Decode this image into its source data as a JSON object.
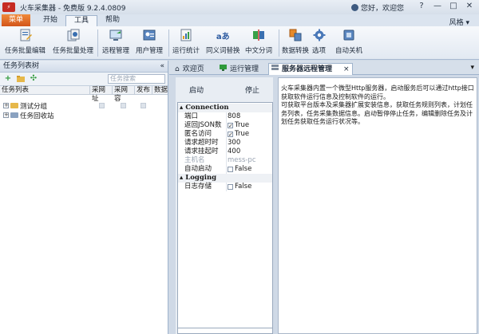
{
  "window": {
    "title": "火车采集器 - 免费版 9.2.4.0809",
    "welcome": "您好，欢迎您",
    "app_icon_glyph": "⚡",
    "controls": [
      "?",
      "—",
      "□",
      "✕"
    ]
  },
  "ribbon": {
    "menu_label": "菜单",
    "tabs": [
      "开始",
      "工具",
      "帮助"
    ],
    "active_tab": "工具",
    "style_menu": "风格 ▾",
    "buttons": [
      {
        "label": "任务批量编辑",
        "icon": "batch-edit-icon"
      },
      {
        "label": "任务批量处理",
        "icon": "batch-process-icon"
      },
      {
        "label": "远程管理",
        "icon": "remote-manage-icon"
      },
      {
        "label": "用户管理",
        "icon": "user-manage-icon"
      },
      {
        "label": "运行统计",
        "icon": "run-stats-icon"
      },
      {
        "label": "同义词替换",
        "icon": "synonym-replace-icon"
      },
      {
        "label": "中文分词",
        "icon": "chinese-segment-icon"
      },
      {
        "label": "数据转换",
        "icon": "data-convert-icon"
      },
      {
        "label": "选项",
        "icon": "gear-icon"
      },
      {
        "label": "自动关机",
        "icon": "auto-shutdown-icon"
      }
    ],
    "synonym_glyph": "aあ"
  },
  "left_pane": {
    "title": "任务列表树",
    "collapse": "«",
    "search_placeholder": "任务搜索",
    "columns": [
      "任务列表",
      "采网址",
      "采网容",
      "发布",
      "数据"
    ],
    "tree": [
      {
        "label": "测试分组"
      },
      {
        "label": "任务回收站"
      }
    ]
  },
  "doc_tabs": {
    "tabs": [
      {
        "label": "欢迎页",
        "icon": "home-icon"
      },
      {
        "label": "运行管理",
        "icon": "monitor-icon"
      },
      {
        "label": "服务器远程管理",
        "icon": "server-icon"
      }
    ],
    "active": "服务器远程管理",
    "close": "×",
    "menu": "▾"
  },
  "server": {
    "start_label": "启动",
    "stop_label": "停止",
    "sections": [
      {
        "name": "Connection",
        "rows": [
          {
            "key": "端口",
            "value": "808"
          },
          {
            "key": "返回JSON数",
            "value": "True",
            "checkbox": true,
            "checked": true
          },
          {
            "key": "匿名访问",
            "value": "True",
            "checkbox": true,
            "checked": true
          },
          {
            "key": "请求超时时",
            "value": "300"
          },
          {
            "key": "请求挂起时",
            "value": "400"
          },
          {
            "key": "主机名",
            "value": "mess-pc",
            "disabled": true
          },
          {
            "key": "自动启动",
            "value": "False",
            "checkbox": true,
            "checked": false
          }
        ]
      },
      {
        "name": "Logging",
        "rows": [
          {
            "key": "日志存储",
            "value": "False",
            "checkbox": true,
            "checked": false
          }
        ]
      }
    ],
    "description": [
      "火车采集器内置一个微型Http服务器，启动服务后可以通过http接口获取软件运行信息及控制软件的运行。",
      "可获取平台版本及采集器扩展安装信息，获取任务规则列表，计划任务列表，任务采集数据信息。启动暂停停止任务，编辑删除任务及计划任务获取任务运行状况等。"
    ]
  },
  "colors": {
    "accent_orange": "#e06a2a",
    "frame_blue": "#cfd9e6"
  }
}
